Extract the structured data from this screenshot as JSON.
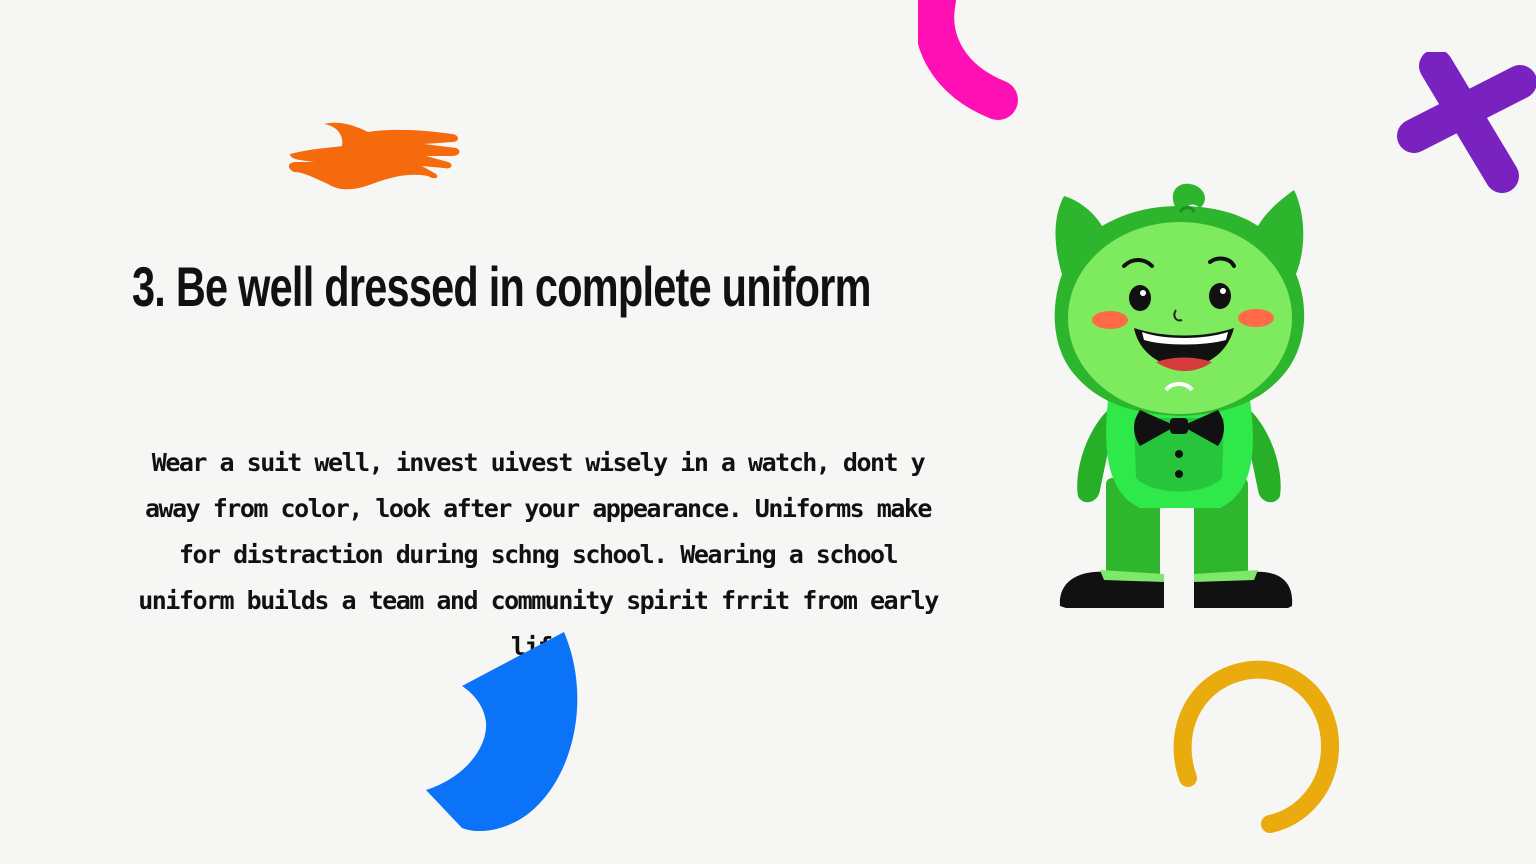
{
  "slide": {
    "title": "3. Be well dressed in complete uniform",
    "body": "Wear a suit well, invest uivest wisely in a watch, dont y away from color, look after your appearance. Uniforms make for distraction during schng school. Wearing a school uniform builds a team and community spirit frrit from early life"
  },
  "decorations": {
    "hand": {
      "icon": "orange-hand-icon",
      "color": "#f46a0c"
    },
    "magenta_arc": {
      "icon": "magenta-arc-icon",
      "color": "#ff10b4"
    },
    "purple_cross": {
      "icon": "purple-cross-icon",
      "color": "#7a22c0"
    },
    "blue_shape": {
      "icon": "blue-crescent-icon",
      "color": "#0a73f7"
    },
    "yellow_ring": {
      "icon": "yellow-ring-icon",
      "color": "#eaab0f"
    },
    "mascot": {
      "icon": "green-mascot-icon",
      "color": "#37c43a"
    }
  }
}
